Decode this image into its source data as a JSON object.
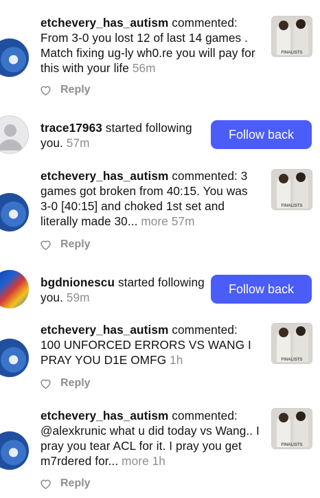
{
  "notifications": [
    {
      "type": "comment",
      "username": "etchevery_has_autism",
      "action": "commented:",
      "text": "From 3-0 you lost 12 of last 14 games . Match fixing ug-ly wh0.re you will pay for this with your life",
      "more": "",
      "time": "56m",
      "reply_label": "Reply",
      "thumb_label": "FINALISTS"
    },
    {
      "type": "follow",
      "username": "trace17963",
      "action": "started following you.",
      "time": "57m",
      "button_label": "Follow back"
    },
    {
      "type": "comment",
      "username": "etchevery_has_autism",
      "action": "commented:",
      "text": "3 games got broken from 40:15. You was 3-0 [40:15] and choked 1st set and literally made 30...",
      "more": "more",
      "time": "57m",
      "reply_label": "Reply",
      "thumb_label": "FINALISTS"
    },
    {
      "type": "follow",
      "username": "bgdnionescu",
      "action": "started following you.",
      "time": "59m",
      "button_label": "Follow back"
    },
    {
      "type": "comment",
      "username": "etchevery_has_autism",
      "action": "commented:",
      "text": "100 UNFORCED ERRORS VS WANG I PRAY YOU D1E OMFG",
      "more": "",
      "time": "1h",
      "reply_label": "Reply",
      "thumb_label": "FINALISTS"
    },
    {
      "type": "comment",
      "username": "etchevery_has_autism",
      "action": "commented:",
      "text": "@alexkrunic what u did today vs Wang.. I pray you tear ACL for it. I pray you get m7rdered for...",
      "more": "more",
      "time": "1h",
      "reply_label": "Reply",
      "thumb_label": "FINALISTS"
    }
  ],
  "icons": {
    "like": "heart-outline-icon",
    "default_avatar": "person-silhouette-icon"
  },
  "colors": {
    "button": "#4a5df9",
    "muted": "#8e8e93"
  }
}
